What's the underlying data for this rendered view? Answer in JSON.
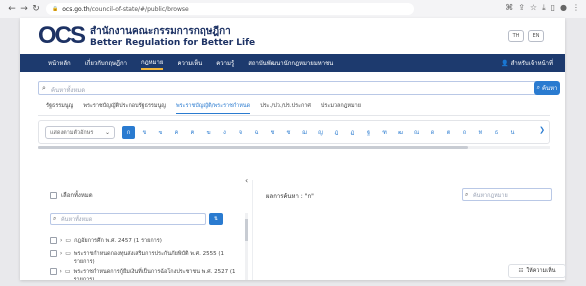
{
  "browser": {
    "url_host": "ocs.go.th",
    "url_path": "/council-of-state/#/public/browse"
  },
  "header": {
    "logo_text": "OCS",
    "org_name_th": "สำนักงานคณะกรรมการกฤษฎีกา",
    "org_name_en": "Better Regulation for Better Life",
    "lang_th": "TH",
    "lang_en": "EN"
  },
  "nav": {
    "items": [
      {
        "label": "หน้าหลัก"
      },
      {
        "label": "เกี่ยวกับกฤษฎีกา"
      },
      {
        "label": "กฎหมาย"
      },
      {
        "label": "ความเห็น"
      },
      {
        "label": "ความรู้"
      },
      {
        "label": "สถาบันพัฒนานักกฎหมายมหาชน"
      }
    ],
    "active_index": 2,
    "staff_label": "สำหรับเจ้าหน้าที่"
  },
  "search": {
    "placeholder": "ค้นหาทั้งหมด",
    "button_label": "ค้นหา"
  },
  "tabs": {
    "items": [
      {
        "label": "รัฐธรรมนูญ"
      },
      {
        "label": "พระราชบัญญัติประกอบรัฐธรรมนูญ"
      },
      {
        "label": "พระราชบัญญัติ/พระราชกำหนด"
      },
      {
        "label": "ประ./ปว./ปร.ประกาศ"
      },
      {
        "label": "ประมวลกฎหมาย"
      }
    ],
    "active_index": 2
  },
  "alphabet": {
    "mode_label": "แสดงตามตัวอักษร",
    "letters": [
      "ก",
      "ข",
      "ฃ",
      "ค",
      "ฅ",
      "ฆ",
      "ง",
      "จ",
      "ฉ",
      "ช",
      "ซ",
      "ฌ",
      "ญ",
      "ฎ",
      "ฏ",
      "ฐ",
      "ฑ",
      "ฒ",
      "ณ",
      "ด",
      "ต",
      "ถ",
      "ท",
      "ธ",
      "น"
    ],
    "active_index": 0
  },
  "sidebar": {
    "select_all": "เลือกทั้งหมด",
    "filter_placeholder": "ค้นหาทั้งหมด",
    "items": [
      {
        "text": "กฎอัยการศึก พ.ศ. 2457 (1 รายการ)"
      },
      {
        "text": "พระราชกำหนดกองทุนส่งเสริมการประกันภัยพิบัติ พ.ศ. 2555 (1 รายการ)"
      },
      {
        "text": "พระราชกำหนดการกู้ยืมเงินที่เป็นการฉ้อโกงประชาชน พ.ศ. 2527 (1 รายการ)"
      }
    ]
  },
  "results": {
    "label": "ผลการค้นหา : \"ก\"",
    "search_placeholder": "ค้นหากฎหมาย"
  },
  "feedback": {
    "label": "ให้ความเห็น"
  }
}
